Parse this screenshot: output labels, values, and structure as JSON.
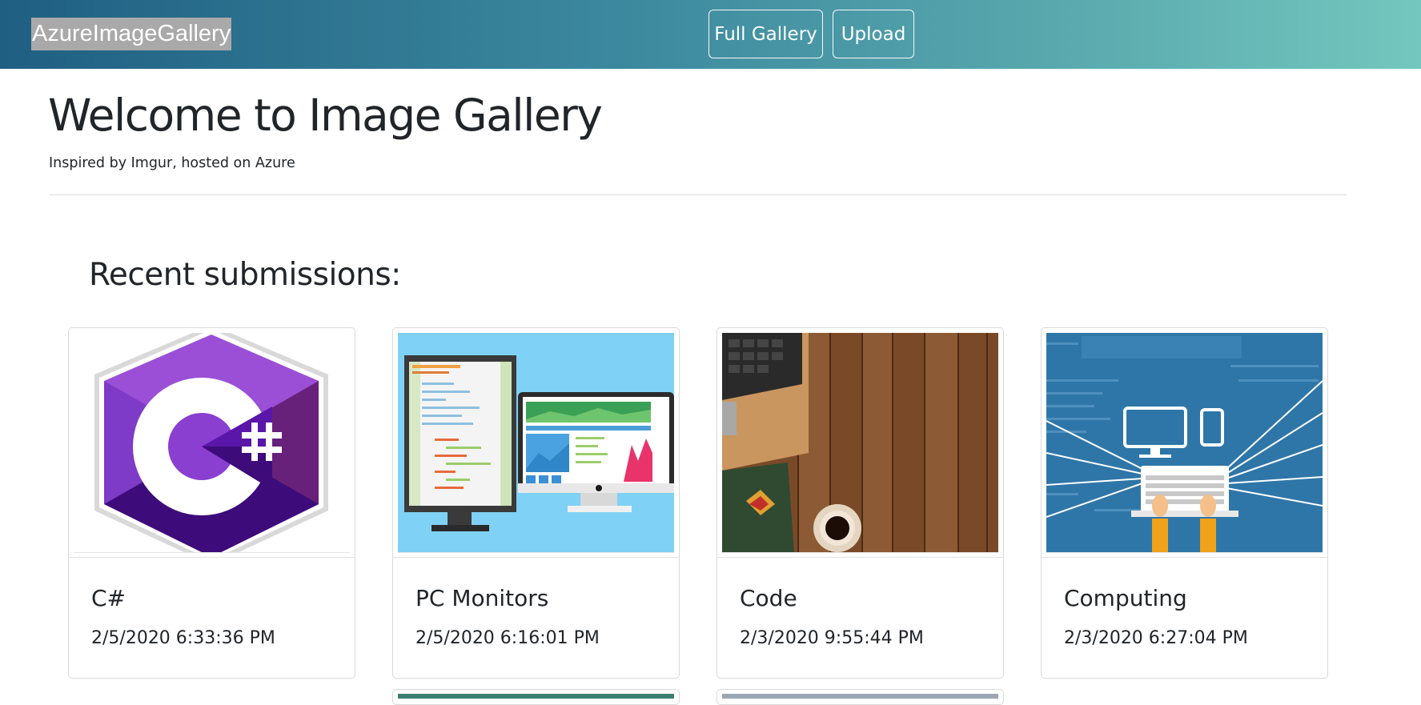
{
  "navbar": {
    "brand": "AzureImageGallery",
    "full_gallery_label": "Full Gallery",
    "upload_label": "Upload"
  },
  "hero": {
    "title": "Welcome to Image Gallery",
    "subtitle": "Inspired by Imgur, hosted on Azure"
  },
  "recent": {
    "heading": "Recent submissions:",
    "cards": [
      {
        "title": "C#",
        "date": "2/5/2020 6:33:36 PM",
        "image_icon": "csharp-logo-icon"
      },
      {
        "title": "PC Monitors",
        "date": "2/5/2020 6:16:01 PM",
        "image_icon": "pc-monitors-illustration"
      },
      {
        "title": "Code",
        "date": "2/3/2020 9:55:44 PM",
        "image_icon": "desk-photo"
      },
      {
        "title": "Computing",
        "date": "2/3/2020 6:27:04 PM",
        "image_icon": "computing-illustration"
      }
    ]
  },
  "colors": {
    "navbar_gradient_start": "#1f5f82",
    "navbar_gradient_end": "#73c7be",
    "brand_highlight": "#a9a9a9",
    "csharp_purple": "#6a1ea5",
    "sky_blue": "#7fd1f5",
    "wood_brown": "#7a4a28",
    "computing_blue": "#2f76a8"
  }
}
